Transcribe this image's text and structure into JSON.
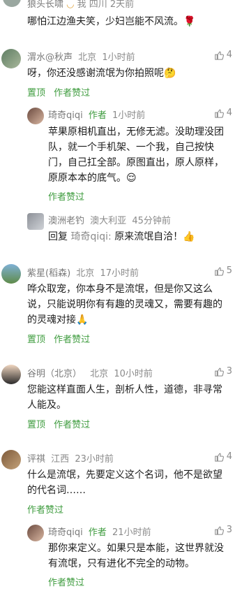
{
  "c0": {
    "meta_name": "狼头长啸",
    "meta_rest": "我  四川  2天前",
    "lines": [
      "哪怕江边渔夫笑，少妇岂能不风流。🌹"
    ]
  },
  "c1": {
    "name": "渭水@秋声",
    "location": "北京",
    "time": "1小时前",
    "like": "4",
    "lines": [
      "呀，你还没感谢流氓为你拍照呢🤔"
    ],
    "actions": [
      "置顶",
      "作者赞过"
    ]
  },
  "r1": {
    "name": "琦奇qiqi",
    "badge": "作者",
    "time": "1小时前",
    "like": "4",
    "lines": [
      "苹果原相机直出，无修无滤。没助理没团",
      "队，就一个手机架、一个我，自己按快",
      "门，自己扛全部。原图直出，原人原样，",
      "原原本本的底气。😌"
    ],
    "actions": [
      "作者赞过"
    ]
  },
  "r2": {
    "name": "澳洲老钓",
    "location": "澳大利亚",
    "time": "45分钟前",
    "reply_prefix": "回复",
    "reply_to": "琦奇qiqi:",
    "reply_text": "原来流氓自洽！👍"
  },
  "c2": {
    "name": "紫星(稻森)",
    "location": "北京",
    "time": "17小时前",
    "like": "5",
    "lines": [
      "哗众取宠，你本身不是流氓，但是你又这么",
      "说，只能说明你有有趣的灵魂又，需要有趣的",
      "的灵魂对接🙏"
    ],
    "actions": [
      "置顶",
      "作者赞过"
    ]
  },
  "c3": {
    "name": "谷明（北京）",
    "location": "北京",
    "time": "10小时前",
    "like": "3",
    "lines": [
      "您能这样直面人生，剖析人性，道德，非寻常",
      "人能及。"
    ],
    "actions": [
      "置顶",
      "作者赞过"
    ]
  },
  "c4": {
    "name": "评祺",
    "location": "江西",
    "time": "23小时前",
    "like": "4",
    "lines": [
      "什么是流氓，先要定义这个名词，他不是欲望",
      "的代名词……"
    ],
    "actions": [
      "作者赞过"
    ]
  },
  "r3": {
    "name": "琦奇qiqi",
    "badge": "作者",
    "time": "21小时前",
    "like": "3",
    "lines": [
      "那你来定义。如果只是本能，这世界就没",
      "有流氓，只有进化不完全的动物。"
    ],
    "actions": [
      "作者赞过"
    ]
  },
  "colors": {
    "accent": "#3f9c3f",
    "meta": "#8a8a8a",
    "text": "#1d1d1d"
  },
  "icons": {
    "like": "thumbs-up-icon"
  }
}
